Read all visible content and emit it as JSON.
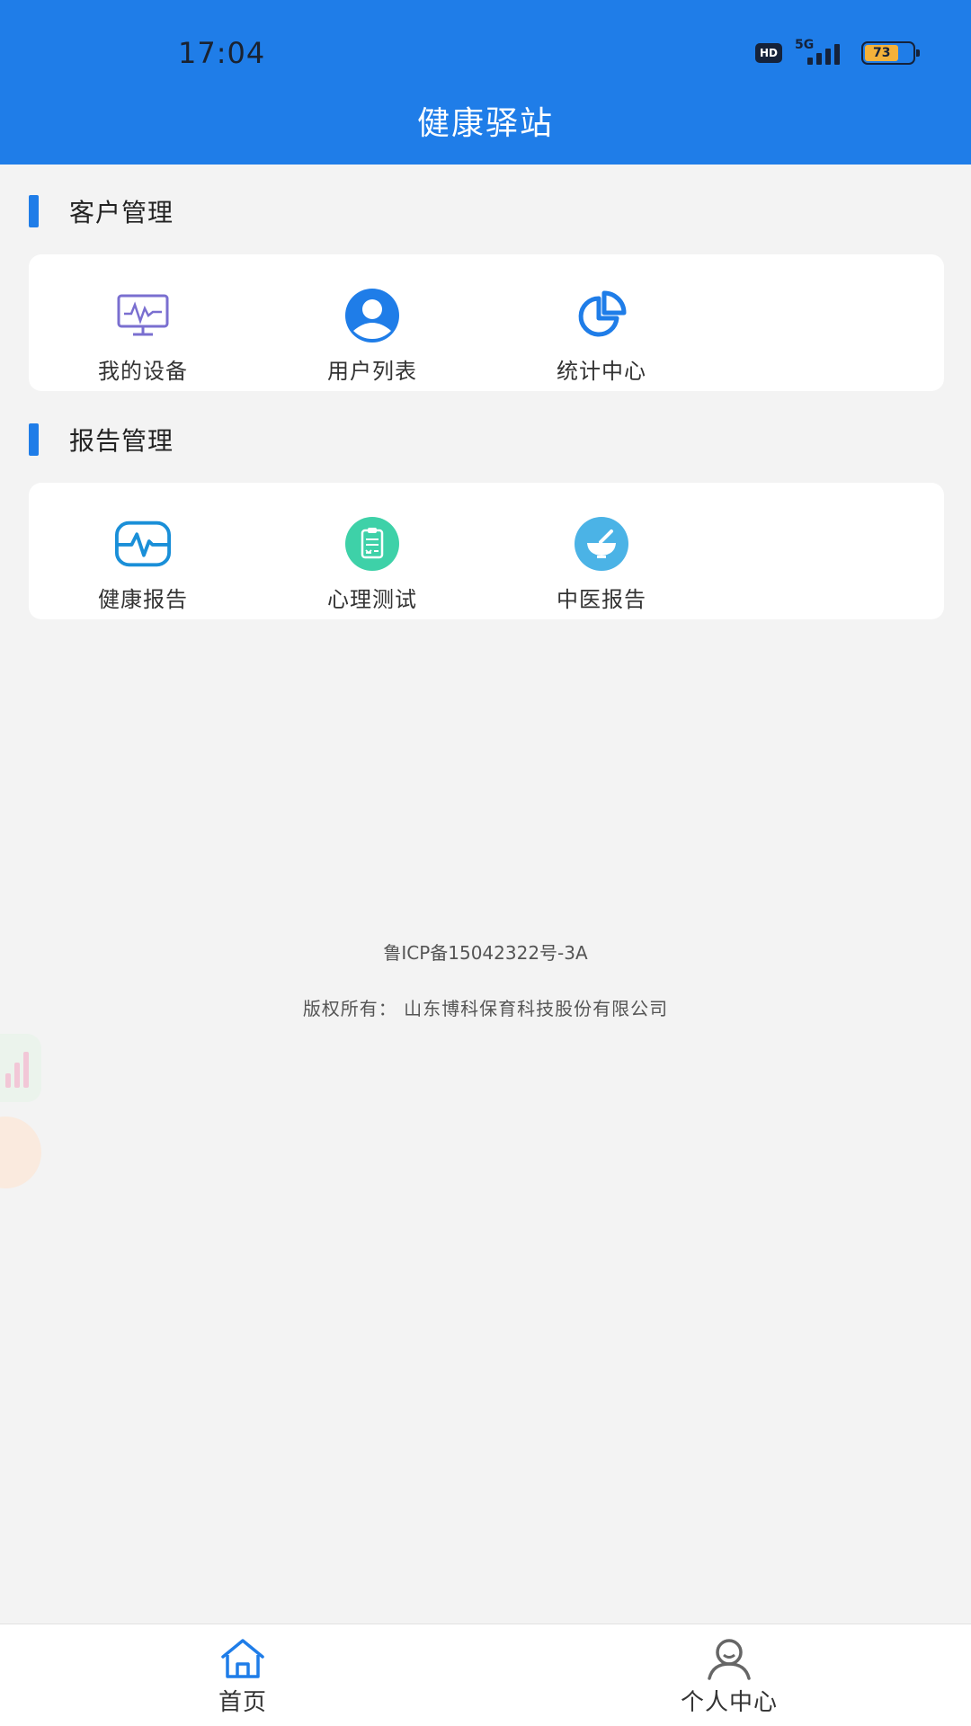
{
  "status_bar": {
    "time": "17:04",
    "hd": "HD",
    "network": "5G",
    "battery": "73"
  },
  "header": {
    "title": "健康驿站"
  },
  "sections": [
    {
      "title": "客户管理",
      "items": [
        {
          "label": "我的设备",
          "icon": "monitor-icon"
        },
        {
          "label": "用户列表",
          "icon": "user-circle-icon"
        },
        {
          "label": "统计中心",
          "icon": "pie-chart-icon"
        }
      ]
    },
    {
      "title": "报告管理",
      "items": [
        {
          "label": "健康报告",
          "icon": "heartbeat-icon"
        },
        {
          "label": "心理测试",
          "icon": "clipboard-icon"
        },
        {
          "label": "中医报告",
          "icon": "mortar-bowl-icon"
        }
      ]
    }
  ],
  "footer": {
    "icp": "鲁ICP备15042322号-3A",
    "copyright": "版权所有：  山东博科保育科技股份有限公司"
  },
  "tabbar": {
    "tabs": [
      {
        "label": "首页",
        "icon": "home-icon",
        "active": true
      },
      {
        "label": "个人中心",
        "icon": "person-icon",
        "active": false
      }
    ]
  },
  "colors": {
    "primary": "#1f7de8",
    "background": "#f3f3f3",
    "card": "#ffffff",
    "monitor_icon": "#7a6fd0",
    "clipboard_icon": "#3ed1a8",
    "bowl_icon": "#4bb3e6"
  }
}
